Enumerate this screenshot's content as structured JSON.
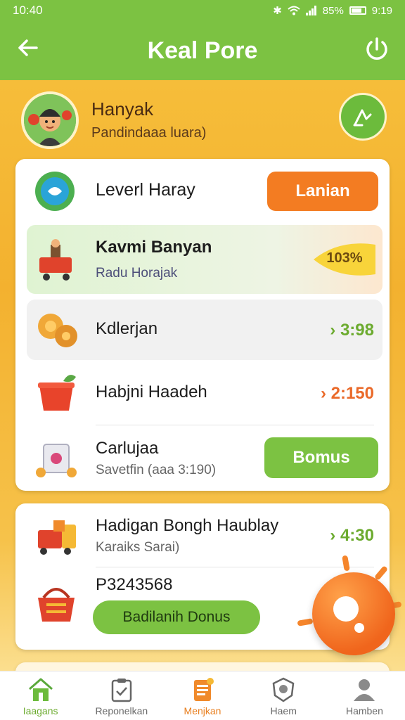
{
  "status_bar": {
    "time": "10:40",
    "battery": "85%",
    "clock_right": "9:19"
  },
  "header": {
    "title": "Keal Pore"
  },
  "profile": {
    "name": "Hanyak",
    "subtitle": "Pandindaaa luara)"
  },
  "main_card": {
    "level_row": {
      "title": "Leverl Haray",
      "button": "Lanian"
    },
    "highlight_row": {
      "title": "Kavmi Banyan",
      "subtitle": "Radu Horajak",
      "badge": "103%"
    },
    "row1": {
      "title": "Kdlerjan",
      "value": "› 3:98"
    },
    "row2": {
      "title": "Habjni Haadeh",
      "value": "› 2:150"
    },
    "row3": {
      "title": "Carlujaa",
      "subtitle": "Savetfin (aaa 3:190)",
      "button": "Bomus"
    }
  },
  "second_card": {
    "row1": {
      "title": "Hadigan Bongh Haublay",
      "subtitle": "Karaiks Sarai)",
      "value": "› 4:30"
    },
    "row2": {
      "title": "P3243568",
      "button": "Badilanih Donus"
    }
  },
  "bottom_nav": [
    {
      "label": "Iaagans",
      "icon": "home-icon"
    },
    {
      "label": "Reponelkan",
      "icon": "clipboard-check-icon"
    },
    {
      "label": "Menjkan",
      "icon": "notepad-icon"
    },
    {
      "label": "Haem",
      "icon": "badge-icon"
    },
    {
      "label": "Hamben",
      "icon": "profile-icon"
    }
  ],
  "colors": {
    "green": "#7cc242",
    "orange": "#f37c22",
    "background": "#f3b12f"
  }
}
